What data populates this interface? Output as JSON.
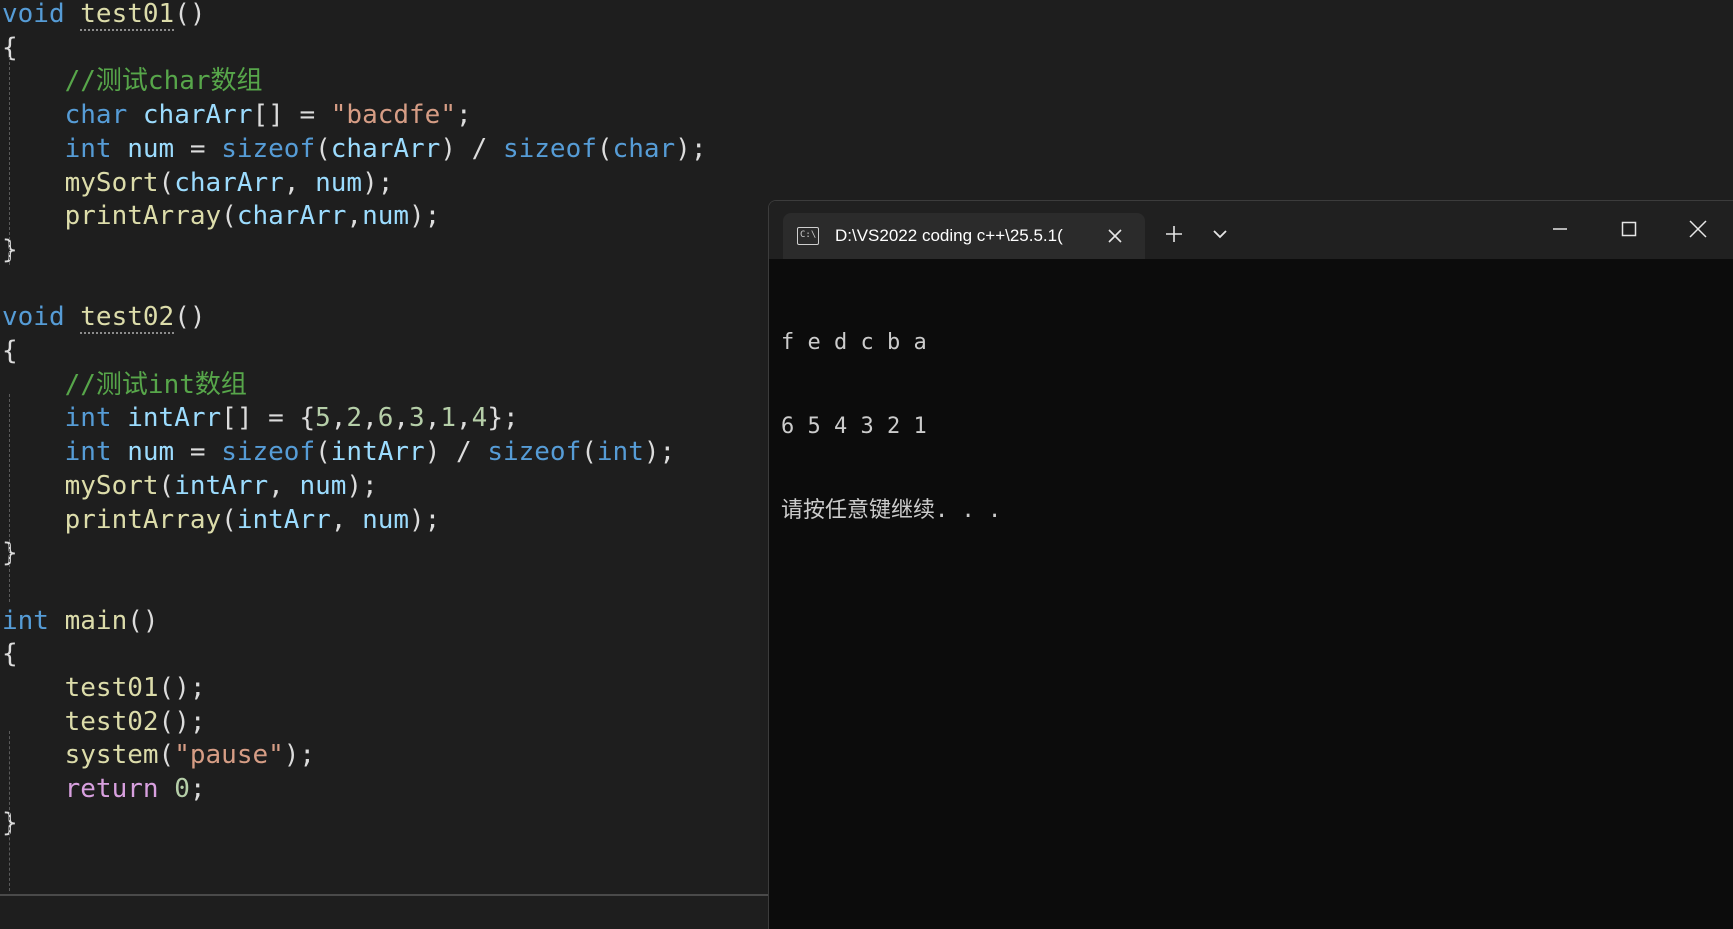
{
  "editor": {
    "lines": [
      [
        [
          "kw",
          "void"
        ],
        [
          "pun",
          " "
        ],
        [
          "fn-sq",
          "test01"
        ],
        [
          "pun",
          "()"
        ]
      ],
      [
        [
          "pun",
          "{"
        ]
      ],
      [
        [
          "pun",
          "    "
        ],
        [
          "cmt",
          "//测试char数组"
        ]
      ],
      [
        [
          "pun",
          "    "
        ],
        [
          "kw",
          "char"
        ],
        [
          "pun",
          " "
        ],
        [
          "var",
          "charArr"
        ],
        [
          "pun",
          "[] = "
        ],
        [
          "str",
          "\"bacdfe\""
        ],
        [
          "pun",
          ";"
        ]
      ],
      [
        [
          "pun",
          "    "
        ],
        [
          "kw",
          "int"
        ],
        [
          "pun",
          " "
        ],
        [
          "var",
          "num"
        ],
        [
          "pun",
          " = "
        ],
        [
          "kw",
          "sizeof"
        ],
        [
          "pun",
          "("
        ],
        [
          "var",
          "charArr"
        ],
        [
          "pun",
          ") / "
        ],
        [
          "kw",
          "sizeof"
        ],
        [
          "pun",
          "("
        ],
        [
          "kw",
          "char"
        ],
        [
          "pun",
          ");"
        ]
      ],
      [
        [
          "pun",
          "    "
        ],
        [
          "fn",
          "mySort"
        ],
        [
          "pun",
          "("
        ],
        [
          "var",
          "charArr"
        ],
        [
          "pun",
          ", "
        ],
        [
          "var",
          "num"
        ],
        [
          "pun",
          ");"
        ]
      ],
      [
        [
          "pun",
          "    "
        ],
        [
          "fn",
          "printArray"
        ],
        [
          "pun",
          "("
        ],
        [
          "var",
          "charArr"
        ],
        [
          "pun",
          ","
        ],
        [
          "var",
          "num"
        ],
        [
          "pun",
          ");"
        ]
      ],
      [
        [
          "pun",
          "}"
        ]
      ],
      [],
      [
        [
          "kw",
          "void"
        ],
        [
          "pun",
          " "
        ],
        [
          "fn-sq",
          "test02"
        ],
        [
          "pun",
          "()"
        ]
      ],
      [
        [
          "pun",
          "{"
        ]
      ],
      [
        [
          "pun",
          "    "
        ],
        [
          "cmt",
          "//测试int数组"
        ]
      ],
      [
        [
          "pun",
          "    "
        ],
        [
          "kw",
          "int"
        ],
        [
          "pun",
          " "
        ],
        [
          "var",
          "intArr"
        ],
        [
          "pun",
          "[] = {"
        ],
        [
          "num",
          "5"
        ],
        [
          "pun",
          ","
        ],
        [
          "num",
          "2"
        ],
        [
          "pun",
          ","
        ],
        [
          "num",
          "6"
        ],
        [
          "pun",
          ","
        ],
        [
          "num",
          "3"
        ],
        [
          "pun",
          ","
        ],
        [
          "num",
          "1"
        ],
        [
          "pun",
          ","
        ],
        [
          "num",
          "4"
        ],
        [
          "pun",
          "};"
        ]
      ],
      [
        [
          "pun",
          "    "
        ],
        [
          "kw",
          "int"
        ],
        [
          "pun",
          " "
        ],
        [
          "var",
          "num"
        ],
        [
          "pun",
          " = "
        ],
        [
          "kw",
          "sizeof"
        ],
        [
          "pun",
          "("
        ],
        [
          "var",
          "intArr"
        ],
        [
          "pun",
          ") / "
        ],
        [
          "kw",
          "sizeof"
        ],
        [
          "pun",
          "("
        ],
        [
          "kw",
          "int"
        ],
        [
          "pun",
          ");"
        ]
      ],
      [
        [
          "pun",
          "    "
        ],
        [
          "fn",
          "mySort"
        ],
        [
          "pun",
          "("
        ],
        [
          "var",
          "intArr"
        ],
        [
          "pun",
          ", "
        ],
        [
          "var",
          "num"
        ],
        [
          "pun",
          ");"
        ]
      ],
      [
        [
          "pun",
          "    "
        ],
        [
          "fn",
          "printArray"
        ],
        [
          "pun",
          "("
        ],
        [
          "var",
          "intArr"
        ],
        [
          "pun",
          ", "
        ],
        [
          "var",
          "num"
        ],
        [
          "pun",
          ");"
        ]
      ],
      [
        [
          "pun",
          "}"
        ]
      ],
      [],
      [
        [
          "kw",
          "int"
        ],
        [
          "pun",
          " "
        ],
        [
          "fn",
          "main"
        ],
        [
          "pun",
          "()"
        ]
      ],
      [
        [
          "pun",
          "{"
        ]
      ],
      [
        [
          "pun",
          "    "
        ],
        [
          "fn",
          "test01"
        ],
        [
          "pun",
          "();"
        ]
      ],
      [
        [
          "pun",
          "    "
        ],
        [
          "fn",
          "test02"
        ],
        [
          "pun",
          "();"
        ]
      ],
      [
        [
          "pun",
          "    "
        ],
        [
          "fn",
          "system"
        ],
        [
          "pun",
          "("
        ],
        [
          "str",
          "\"pause\""
        ],
        [
          "pun",
          ");"
        ]
      ],
      [
        [
          "pun",
          "    "
        ],
        [
          "ctl",
          "return"
        ],
        [
          "pun",
          " "
        ],
        [
          "num",
          "0"
        ],
        [
          "pun",
          ";"
        ]
      ],
      [
        [
          "pun",
          "}"
        ]
      ]
    ]
  },
  "terminal": {
    "tab_title": "D:\\VS2022 coding c++\\25.5.1(",
    "tab_icon_text": "C:\\",
    "output": [
      "f e d c b a",
      "6 5 4 3 2 1",
      "请按任意键继续. . ."
    ],
    "icons": {
      "tab_icon": "terminal-app-icon",
      "tab_close": "close-icon",
      "new_tab": "plus-icon",
      "dropdown": "chevron-down-icon",
      "minimize": "minimize-icon",
      "maximize": "maximize-icon",
      "close": "close-icon"
    }
  },
  "colors": {
    "editor_bg": "#1e1e1e",
    "keyword": "#569cd6",
    "control": "#d8a0df",
    "function": "#dcdcaa",
    "variable": "#9cdcfe",
    "string": "#d69d85",
    "number": "#b5cea8",
    "comment": "#57a64a",
    "terminal_bg": "#0c0c0c"
  }
}
